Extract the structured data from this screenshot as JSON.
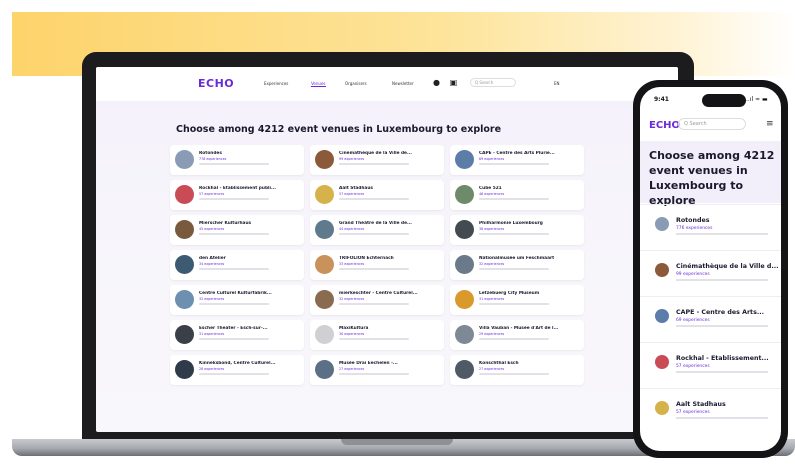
{
  "site": {
    "logo": "ECHO",
    "nav": [
      "Experiences",
      "Venues",
      "Organisers",
      "Newsletter"
    ],
    "active_nav": "Venues",
    "search_placeholder": "Q Search",
    "language": "EN"
  },
  "heading": "Choose among 4212 event venues in Luxembourg to explore",
  "venues": [
    {
      "name": "Rotondes",
      "count": "776 experiences",
      "color": "#8a9bb5"
    },
    {
      "name": "Cinémathèque de la Ville de...",
      "count": "99 experiences",
      "color": "#8a5a3a"
    },
    {
      "name": "CAPE - Centre des Arts Plurie...",
      "count": "69 experiences",
      "color": "#5b7da8"
    },
    {
      "name": "Rockhal - Etablissement publi...",
      "count": "57 experiences",
      "color": "#c94b55"
    },
    {
      "name": "Aalt Stadhaus",
      "count": "57 experiences",
      "color": "#d6b34a"
    },
    {
      "name": "Cube 521",
      "count": "46 experiences",
      "color": "#6f8a6a"
    },
    {
      "name": "Mierscher Kulturhaus",
      "count": "45 experiences",
      "color": "#7a5a3e"
    },
    {
      "name": "Grand Théâtre de la Ville de...",
      "count": "44 experiences",
      "color": "#5f7a8c"
    },
    {
      "name": "Philharmonie Luxembourg",
      "count": "38 experiences",
      "color": "#444a52"
    },
    {
      "name": "den Atelier",
      "count": "34 experiences",
      "color": "#3d5a73"
    },
    {
      "name": "TRIFOLION Echternach",
      "count": "33 experiences",
      "color": "#c9925a"
    },
    {
      "name": "Nationalmusée um Fëschmaart",
      "count": "32 experiences",
      "color": "#6b7a8a"
    },
    {
      "name": "Centre Culturel Kulturfabrik...",
      "count": "32 experiences",
      "color": "#6d8fb0"
    },
    {
      "name": "mierkeschter - Centre Culturel...",
      "count": "32 experiences",
      "color": "#8a6b4f"
    },
    {
      "name": "Lëtzebuerg City Museum",
      "count": "31 experiences",
      "color": "#d99a2b"
    },
    {
      "name": "Escher Theater - Esch-sur-...",
      "count": "31 experiences",
      "color": "#3a3f48"
    },
    {
      "name": "MaxiKultura",
      "count": "30 experiences",
      "color": "#cfcfd4"
    },
    {
      "name": "Villa Vauban - Musée d'Art de l...",
      "count": "29 experiences",
      "color": "#7d8a95"
    },
    {
      "name": "Kinneksbond, Centre Culturel...",
      "count": "28 experiences",
      "color": "#2f3a4a"
    },
    {
      "name": "Musée Dräi Eechelen -...",
      "count": "27 experiences",
      "color": "#5b6f86"
    },
    {
      "name": "Konschthal Esch",
      "count": "27 experiences",
      "color": "#4f5a66"
    }
  ],
  "phone": {
    "time": "9:41",
    "status": "..ıl ≈ ▬",
    "logo": "ECHO",
    "search_placeholder": "Q Search",
    "menu": "≡",
    "heading": "Choose among 4212 event venues in Luxembourg to explore",
    "venues": [
      {
        "name": "Rotondes",
        "count": "776 experiences",
        "color": "#8a9bb5"
      },
      {
        "name": "Cinémathèque de la Ville d...",
        "count": "99 experiences",
        "color": "#8a5a3a"
      },
      {
        "name": "CAPE - Centre des Arts...",
        "count": "69 experiences",
        "color": "#5b7da8"
      },
      {
        "name": "Rockhal - Etablissement...",
        "count": "57 experiences",
        "color": "#c94b55"
      },
      {
        "name": "Aalt Stadhaus",
        "count": "57 experiences",
        "color": "#d6b34a"
      }
    ]
  },
  "colors": {
    "accent": "#6a2bd8",
    "band": "#fdd36b"
  }
}
